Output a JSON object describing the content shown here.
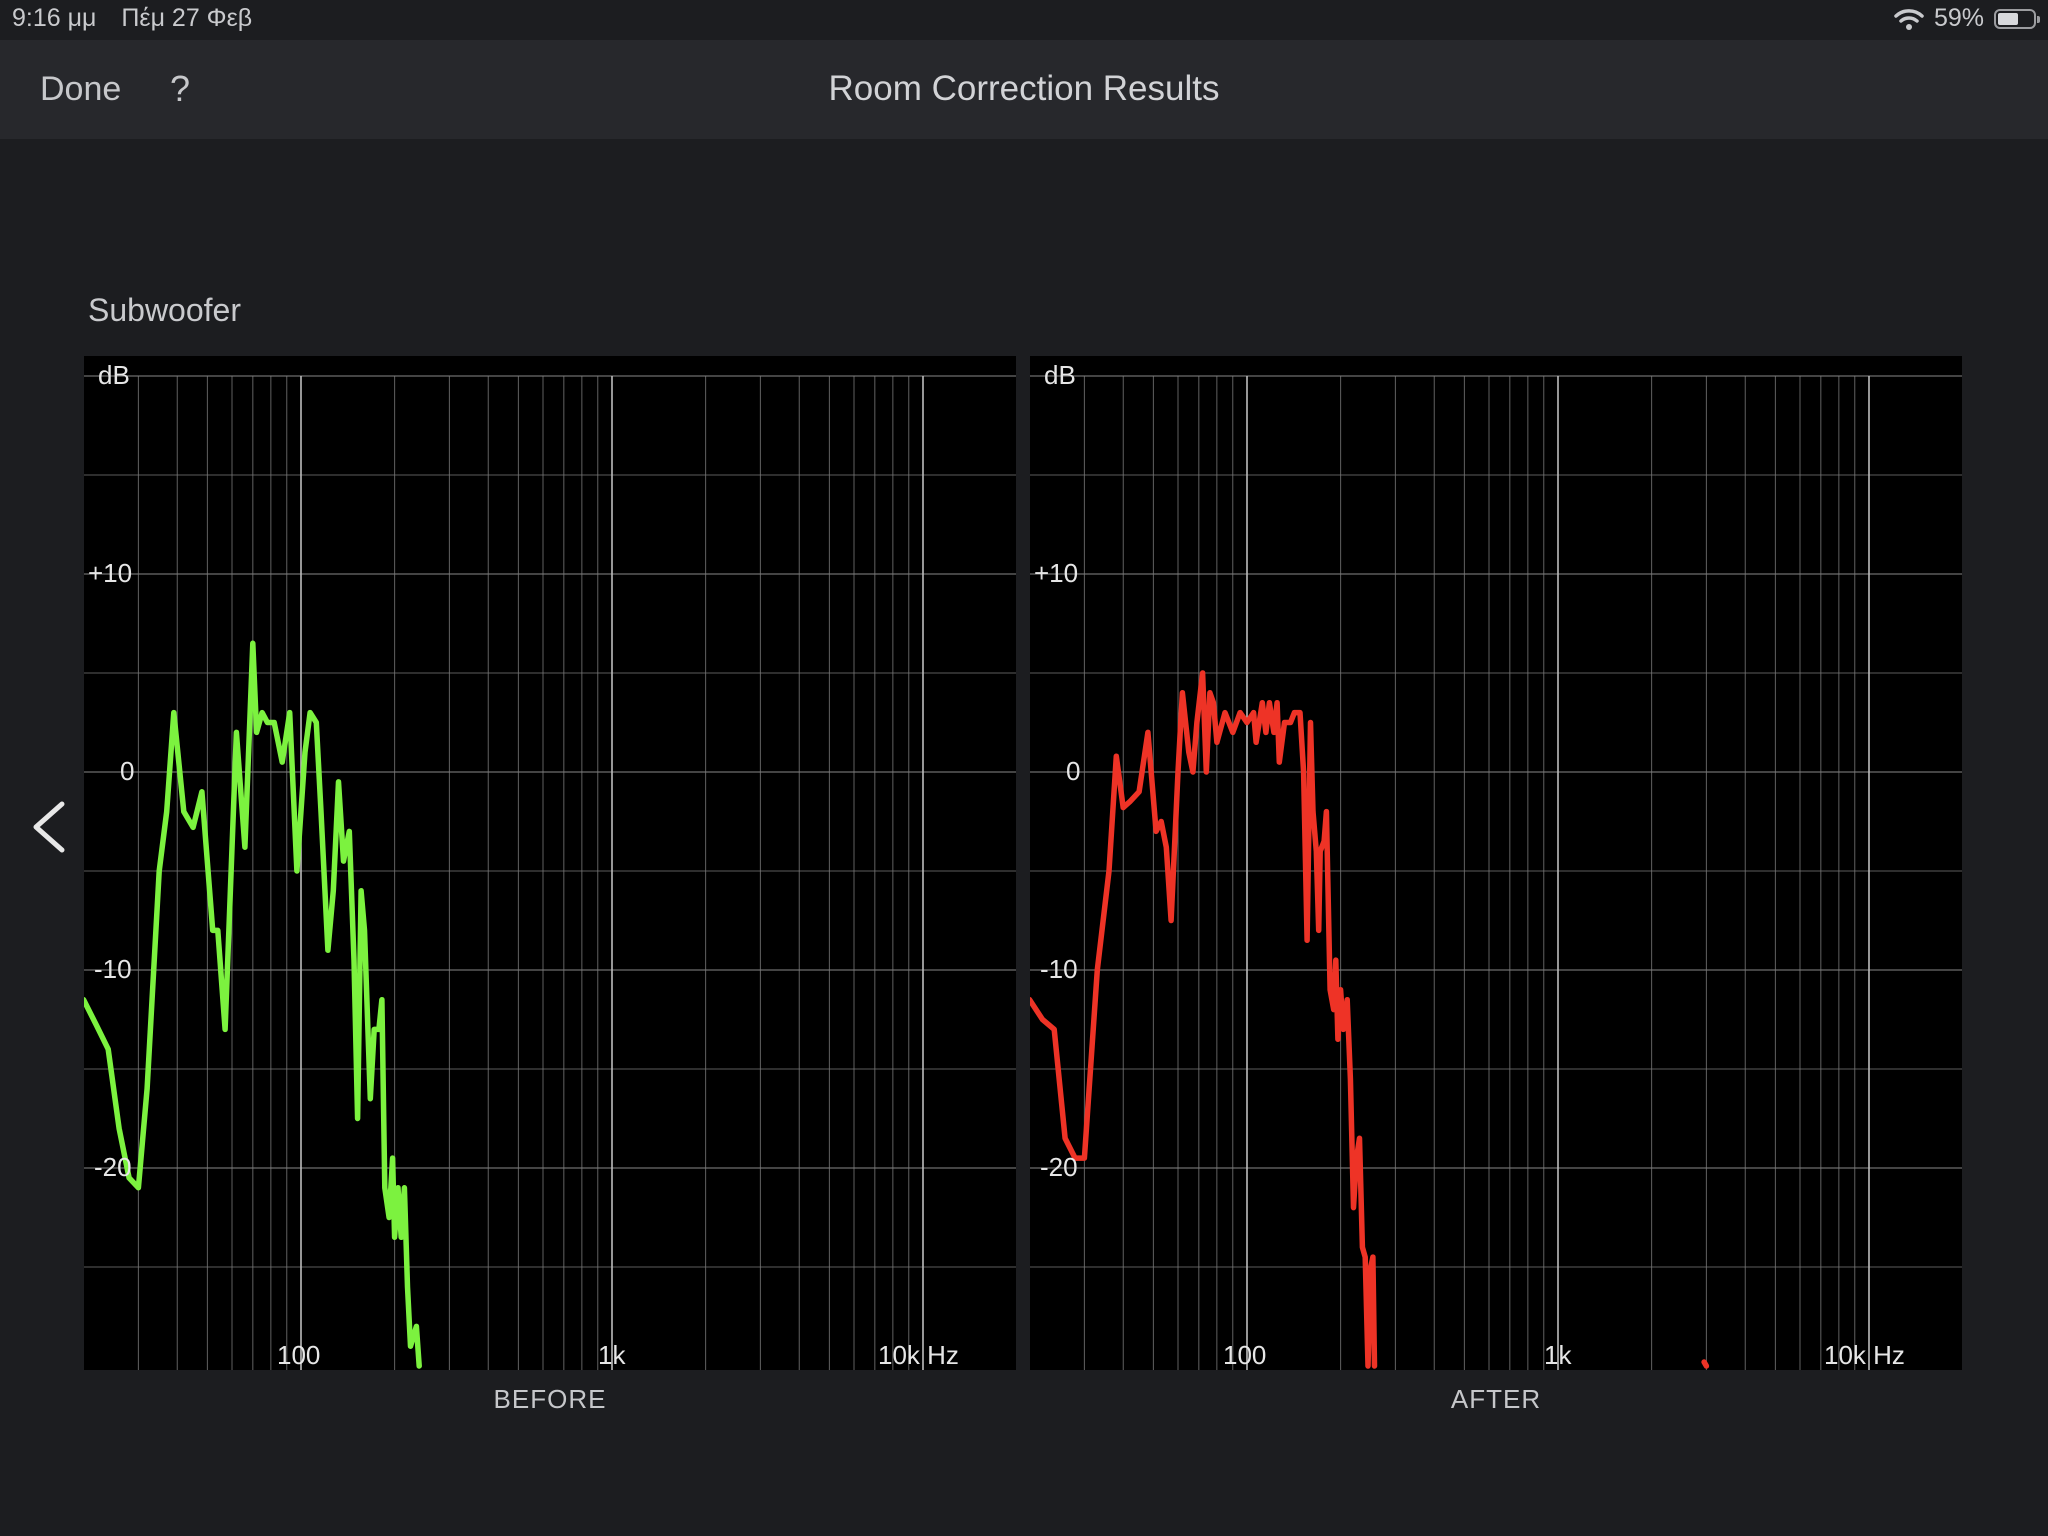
{
  "status_bar": {
    "time": "9:16 μμ",
    "date": "Πέμ 27 Φεβ",
    "battery": "59%",
    "battery_level": 0.59
  },
  "nav": {
    "done_label": "Done",
    "help_label": "?",
    "title": "Room Correction Results"
  },
  "section_title": "Subwoofer",
  "colors": {
    "before_line": "#7cf23f",
    "after_line": "#ee3326",
    "grid": "#7a7a7a"
  },
  "axes": {
    "y_unit": "dB",
    "y_ticks": [
      "+10",
      "0",
      "-10",
      "-20"
    ],
    "x_ticks": [
      "100",
      "1k",
      "10k Hz"
    ]
  },
  "chart_data": [
    {
      "type": "line",
      "title": "BEFORE",
      "xlabel": "Hz",
      "ylabel": "dB",
      "xscale": "log",
      "xlim": [
        20,
        20000
      ],
      "ylim": [
        -30,
        20
      ],
      "grid": true,
      "series": [
        {
          "color": "#7cf23f",
          "points": [
            [
              20,
              -11.5
            ],
            [
              22,
              -12.8
            ],
            [
              24,
              -14
            ],
            [
              26,
              -18
            ],
            [
              28,
              -20.5
            ],
            [
              30,
              -21
            ],
            [
              32,
              -16
            ],
            [
              35,
              -5
            ],
            [
              37,
              -2
            ],
            [
              39,
              3
            ],
            [
              42,
              -2
            ],
            [
              45,
              -2.8
            ],
            [
              48,
              -1
            ],
            [
              52,
              -8
            ],
            [
              54,
              -8
            ],
            [
              57,
              -13
            ],
            [
              62,
              2
            ],
            [
              66,
              -3.8
            ],
            [
              70,
              6.5
            ],
            [
              72,
              2
            ],
            [
              75,
              3
            ],
            [
              78,
              2.5
            ],
            [
              82,
              2.5
            ],
            [
              87,
              0.5
            ],
            [
              92,
              3
            ],
            [
              97,
              -5
            ],
            [
              103,
              1
            ],
            [
              107,
              3
            ],
            [
              112,
              2.5
            ],
            [
              116,
              -2
            ],
            [
              122,
              -9
            ],
            [
              127,
              -6
            ],
            [
              132,
              -0.5
            ],
            [
              137,
              -4.5
            ],
            [
              143,
              -3
            ],
            [
              148,
              -9.5
            ],
            [
              152,
              -17.5
            ],
            [
              156,
              -6
            ],
            [
              160,
              -8
            ],
            [
              167,
              -16.5
            ],
            [
              172,
              -13
            ],
            [
              178,
              -13
            ],
            [
              182,
              -11.5
            ],
            [
              186,
              -21
            ],
            [
              192,
              -22.5
            ],
            [
              197,
              -19.5
            ],
            [
              200,
              -23.5
            ],
            [
              205,
              -21
            ],
            [
              210,
              -23.5
            ],
            [
              215,
              -21
            ],
            [
              220,
              -26
            ],
            [
              225,
              -29
            ],
            [
              235,
              -28
            ],
            [
              240,
              -30
            ]
          ]
        }
      ]
    },
    {
      "type": "line",
      "title": "AFTER",
      "xlabel": "Hz",
      "ylabel": "dB",
      "xscale": "log",
      "xlim": [
        20,
        20000
      ],
      "ylim": [
        -30,
        20
      ],
      "grid": true,
      "series": [
        {
          "color": "#ee3326",
          "points": [
            [
              20,
              -11.5
            ],
            [
              22,
              -12.5
            ],
            [
              24,
              -13
            ],
            [
              26,
              -18.5
            ],
            [
              28,
              -19.5
            ],
            [
              30,
              -19.5
            ],
            [
              33,
              -10
            ],
            [
              36,
              -5
            ],
            [
              38,
              0.8
            ],
            [
              40,
              -1.8
            ],
            [
              42,
              -1.5
            ],
            [
              45,
              -1
            ],
            [
              48,
              2
            ],
            [
              51,
              -3
            ],
            [
              53,
              -2.5
            ],
            [
              55,
              -3.8
            ],
            [
              57,
              -7.5
            ],
            [
              60,
              0
            ],
            [
              62,
              4
            ],
            [
              65,
              1
            ],
            [
              67,
              0
            ],
            [
              69,
              2.5
            ],
            [
              72,
              5
            ],
            [
              74,
              0
            ],
            [
              76,
              4
            ],
            [
              78,
              3.5
            ],
            [
              80,
              1.5
            ],
            [
              85,
              3
            ],
            [
              90,
              2
            ],
            [
              95,
              3
            ],
            [
              100,
              2.5
            ],
            [
              105,
              3
            ],
            [
              107,
              1.5
            ],
            [
              112,
              3.5
            ],
            [
              115,
              2
            ],
            [
              118,
              3.5
            ],
            [
              122,
              2
            ],
            [
              125,
              3.5
            ],
            [
              127,
              0.5
            ],
            [
              132,
              2.5
            ],
            [
              138,
              2.5
            ],
            [
              142,
              3
            ],
            [
              148,
              3
            ],
            [
              152,
              0
            ],
            [
              156,
              -8.5
            ],
            [
              160,
              2.5
            ],
            [
              163,
              -2
            ],
            [
              167,
              -4
            ],
            [
              170,
              -8
            ],
            [
              172,
              -4
            ],
            [
              177,
              -3.5
            ],
            [
              180,
              -2
            ],
            [
              185,
              -11
            ],
            [
              190,
              -12
            ],
            [
              193,
              -9.5
            ],
            [
              196,
              -13.5
            ],
            [
              200,
              -11
            ],
            [
              204,
              -13
            ],
            [
              210,
              -11.5
            ],
            [
              215,
              -15.5
            ],
            [
              220,
              -22
            ],
            [
              225,
              -19.5
            ],
            [
              230,
              -18.5
            ],
            [
              235,
              -24
            ],
            [
              240,
              -24.5
            ],
            [
              245,
              -30
            ],
            [
              250,
              -25
            ],
            [
              254,
              -24.5
            ],
            [
              257,
              -30
            ]
          ]
        },
        {
          "color": "#ee3326",
          "points": [
            [
              2950,
              -29.8
            ],
            [
              3000,
              -30
            ]
          ]
        }
      ]
    }
  ]
}
